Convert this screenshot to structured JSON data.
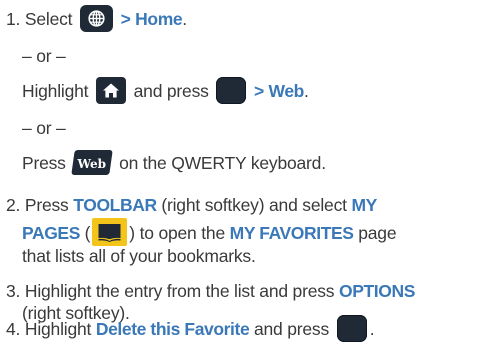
{
  "steps": [
    {
      "number": "1.",
      "select_text": "Select",
      "gt": ">",
      "home_label": "Home",
      "period": ".",
      "or_1": "– or –",
      "highlight_text": "Highlight",
      "and_press": "and press",
      "web_label": "Web",
      "or_2": "– or –",
      "press_text": "Press",
      "web_key_label": "Web",
      "on_qwerty": "on the QWERTY keyboard."
    },
    {
      "number": "2.",
      "press_text": "Press",
      "toolbar_label": "TOOLBAR",
      "right_softkey_select": "(right softkey) and select",
      "my_label": "MY",
      "pages_label": "PAGES",
      "paren_open": "(",
      "paren_close": ")",
      "to_open_the": "to open the",
      "my_favorites_label": "MY FAVORITES",
      "page_word": "page",
      "line3": "that lists all of your bookmarks."
    },
    {
      "number": "3.",
      "line1_text": "Highlight the entry from the list and press",
      "options_label": "OPTIONS",
      "line2": "(right softkey)."
    },
    {
      "number": "4.",
      "highlight_text": "Highlight",
      "delete_label": "Delete this Favorite",
      "and_press": "and press",
      "period": "."
    }
  ],
  "icons": {
    "globe": "globe-icon",
    "home": "home-icon",
    "ok": "ok-key-icon",
    "web_key": "web-key-icon",
    "book": "book-icon"
  },
  "colors": {
    "accent_blue": "#3b78b8",
    "key_dark": "#1f2a36",
    "book_yellow": "#f3c51a",
    "body_text": "#3a3a3a"
  }
}
